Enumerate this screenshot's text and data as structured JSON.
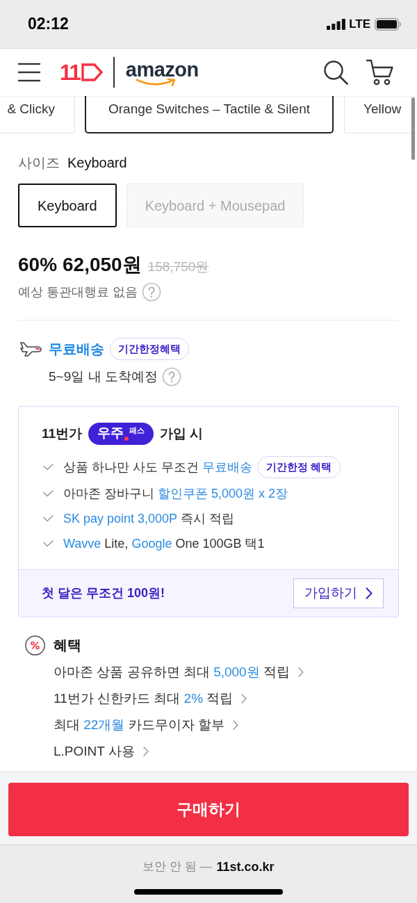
{
  "status_bar": {
    "time": "02:12",
    "network": "LTE"
  },
  "header": {
    "logo_text": "11",
    "partner": "amazon"
  },
  "option_chips": [
    {
      "label": "& Clicky",
      "selected": false
    },
    {
      "label": "Orange Switches – Tactile & Silent",
      "selected": true
    },
    {
      "label": "Yellow",
      "selected": false
    }
  ],
  "size": {
    "label": "사이즈",
    "value": "Keyboard",
    "options": [
      {
        "label": "Keyboard",
        "selected": true,
        "disabled": false
      },
      {
        "label": "Keyboard + Mousepad",
        "selected": false,
        "disabled": true
      }
    ]
  },
  "price": {
    "discount": "60%",
    "price": "62,050원",
    "original": "158,750원",
    "customs_note": "예상 통관대행료 없음"
  },
  "shipping": {
    "title": "무료배송",
    "badge": "기간한정혜택",
    "eta": "5~9일 내 도착예정"
  },
  "pass": {
    "prefix": "11번가",
    "logo_main": "우주",
    "logo_sub": "패스",
    "suffix": "가입 시",
    "benefits": [
      {
        "segments": [
          {
            "text": "상품 하나만 사도 무조건 ",
            "highlight": false
          },
          {
            "text": "무료배송",
            "highlight": true
          }
        ],
        "badge": "기간한정 혜택"
      },
      {
        "segments": [
          {
            "text": "아마존 장바구니 ",
            "highlight": false
          },
          {
            "text": "할인쿠폰 5,000원 x 2장",
            "highlight": true
          }
        ]
      },
      {
        "segments": [
          {
            "text": "SK pay point 3,000P",
            "highlight": true
          },
          {
            "text": " 즉시 적립",
            "highlight": false
          }
        ]
      },
      {
        "segments": [
          {
            "text": "Wavve",
            "highlight": true
          },
          {
            "text": " Lite, ",
            "highlight": false
          },
          {
            "text": "Google",
            "highlight": true
          },
          {
            "text": " One 100GB 택1",
            "highlight": false
          }
        ]
      }
    ],
    "promo": "첫 달은 무조건 100원!",
    "join_button": "가입하기"
  },
  "benefits": {
    "title": "혜택",
    "items": [
      {
        "segments": [
          {
            "text": "아마존 상품 공유하면 최대 ",
            "highlight": false
          },
          {
            "text": "5,000원",
            "highlight": true
          },
          {
            "text": " 적립",
            "highlight": false
          }
        ]
      },
      {
        "segments": [
          {
            "text": "11번가 신한카드 최대 ",
            "highlight": false
          },
          {
            "text": "2%",
            "highlight": true
          },
          {
            "text": " 적립",
            "highlight": false
          }
        ]
      },
      {
        "segments": [
          {
            "text": "최대 ",
            "highlight": false
          },
          {
            "text": "22개월",
            "highlight": true
          },
          {
            "text": " 카드무이자 할부",
            "highlight": false
          }
        ]
      },
      {
        "segments": [
          {
            "text": "L.POINT 사용",
            "highlight": false
          }
        ]
      }
    ]
  },
  "buy_button": "구매하기",
  "browser_bar": {
    "security": "보안 안 됨 —",
    "domain": "11st.co.kr"
  }
}
